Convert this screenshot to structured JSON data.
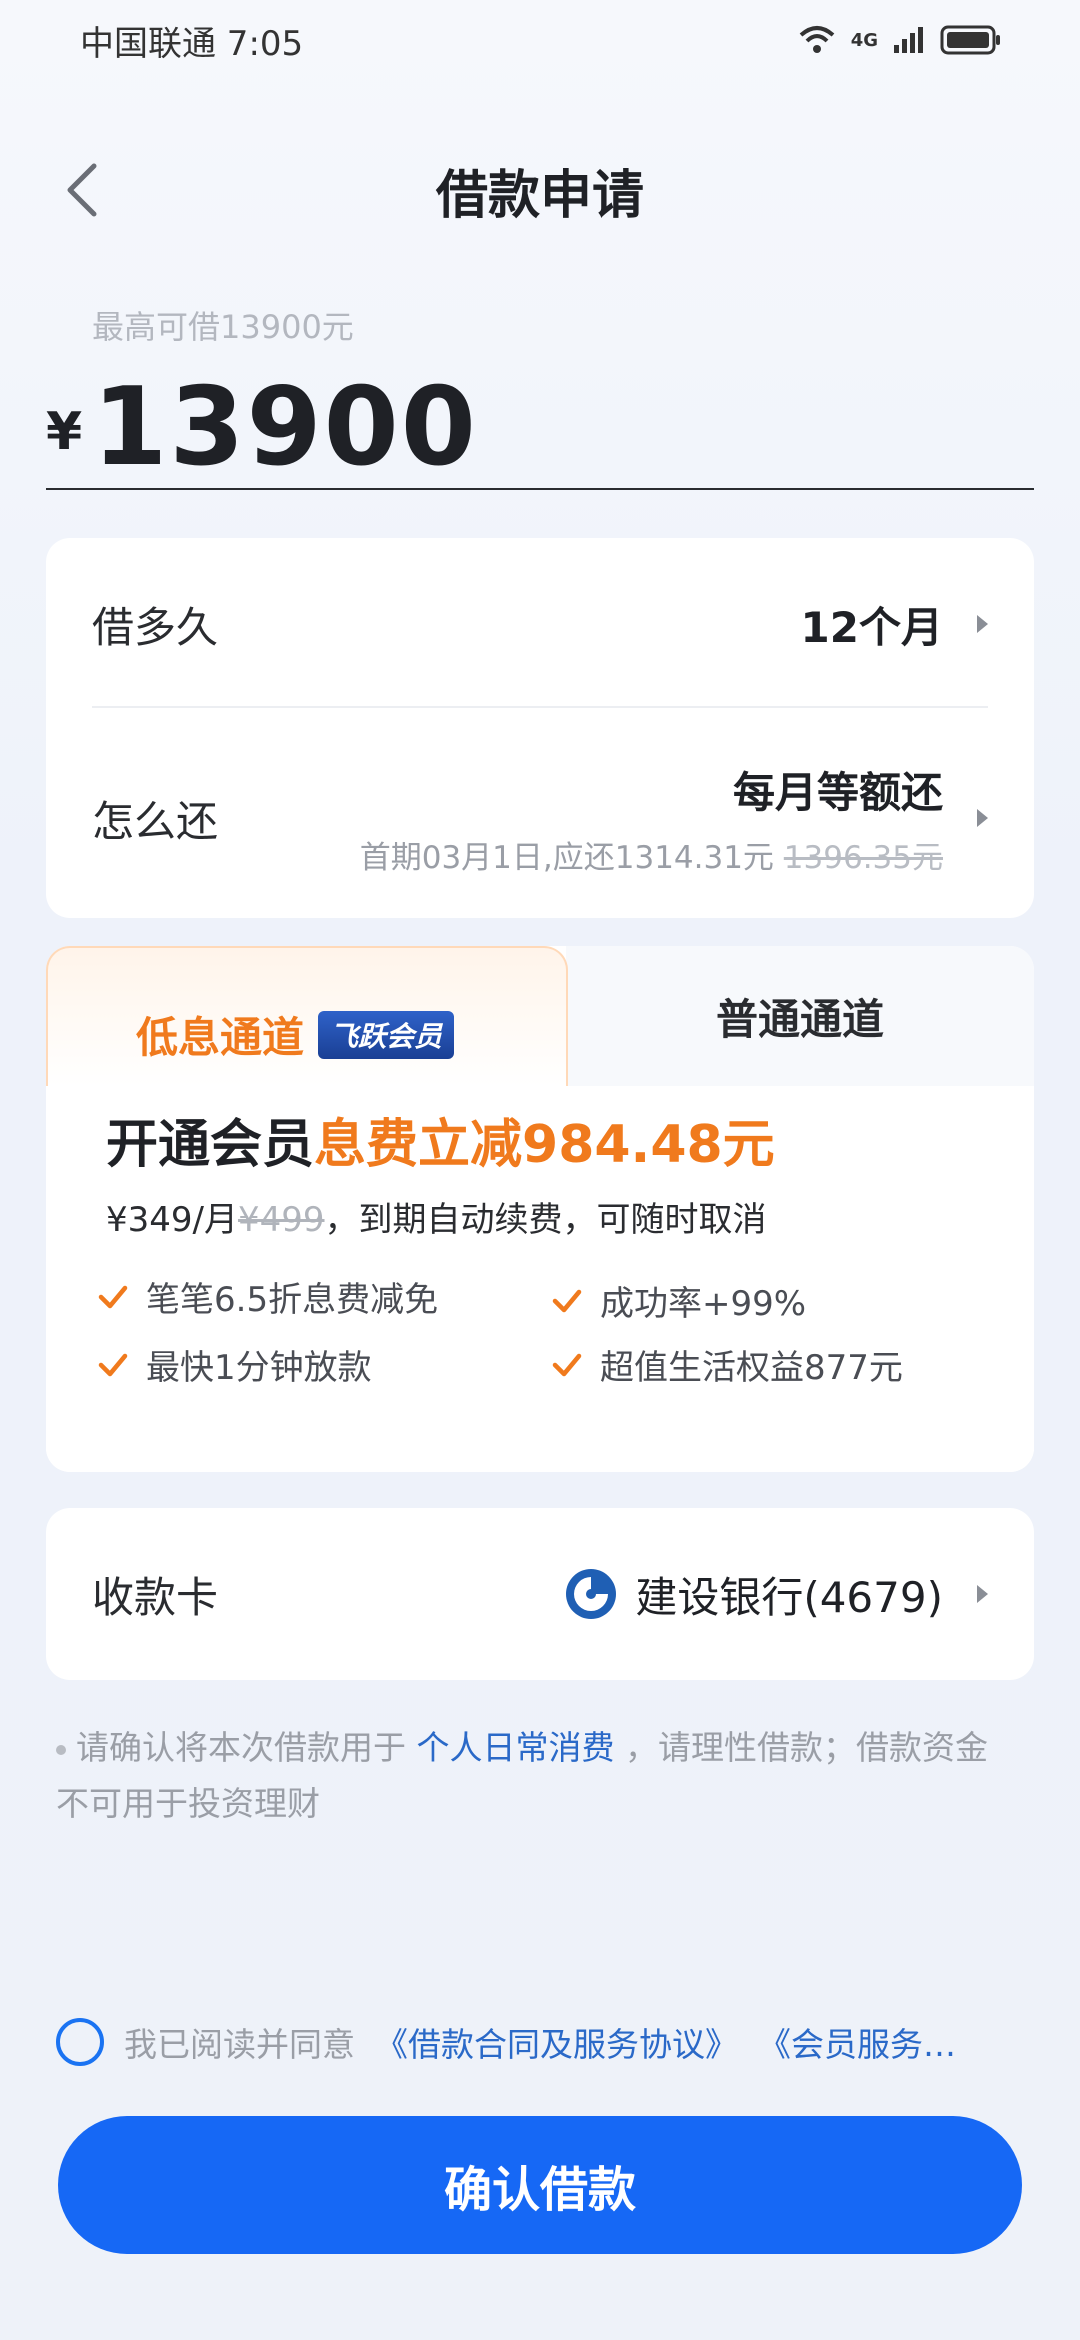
{
  "status_bar": {
    "carrier_time": "中国联通 7:05",
    "network": "4G"
  },
  "header": {
    "title": "借款申请"
  },
  "amount": {
    "limit_hint": "最高可借13900元",
    "currency": "¥",
    "value": "13900"
  },
  "loan_terms": {
    "duration_label": "借多久",
    "duration_value": "12个月",
    "repay_label": "怎么还",
    "repay_method": "每月等额还",
    "repay_first_period": "首期03月1日,应还1314.31元",
    "repay_original": "1396.35元"
  },
  "channel": {
    "low_interest_tab": "低息通道",
    "vip_badge": "飞跃会员",
    "normal_tab": "普通通道",
    "member_title_prefix": "开通会员",
    "member_title_highlight": "息费立减984.48元",
    "price_current": "¥349/月",
    "price_original": "¥499",
    "price_note": "，到期自动续费，可随时取消",
    "benefits": [
      "笔笔6.5折息费减免",
      "成功率+99%",
      "最快1分钟放款",
      "超值生活权益877元"
    ]
  },
  "bank": {
    "label": "收款卡",
    "name": "建设银行(4679)"
  },
  "notice": {
    "prefix": "请确认将本次借款用于",
    "purpose": "个人日常消费",
    "suffix": "，请理性借款；借款资金不可用于投资理财"
  },
  "agreement": {
    "text": "我已阅读并同意",
    "link1": "《借款合同及服务协议》",
    "link2": "《会员服务…"
  },
  "confirm_button": "确认借款",
  "colors": {
    "primary": "#1668f5",
    "accent_orange": "#f07a1d",
    "link": "#2a69c8"
  }
}
